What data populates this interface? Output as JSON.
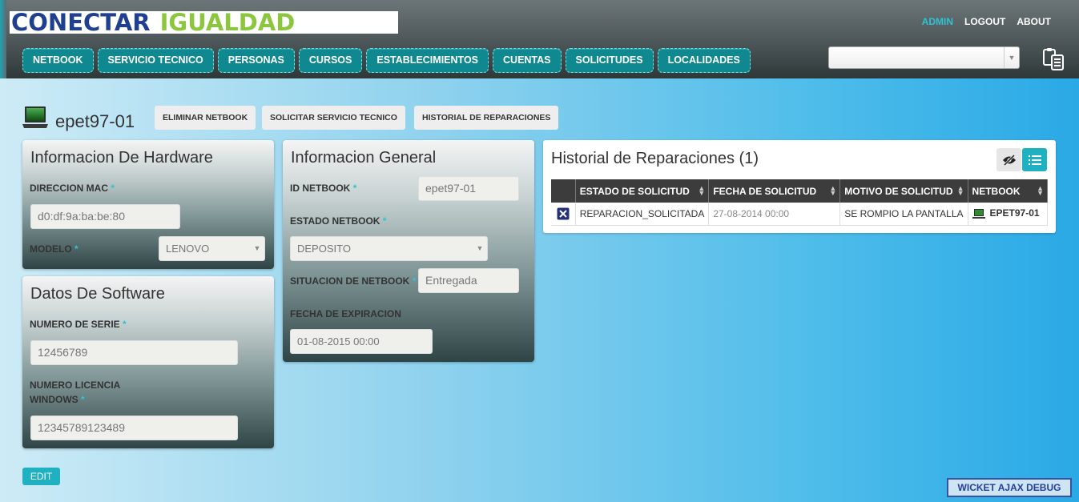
{
  "header": {
    "logo_part1": "CONECTAR",
    "logo_part2": "IGUALDAD",
    "links": [
      "ADMIN",
      "LOGOUT",
      "ABOUT"
    ],
    "nav_items": [
      "NETBOOK",
      "SERVICIO TECNICO",
      "PERSONAS",
      "CURSOS",
      "ESTABLECIMIENTOS",
      "CUENTAS",
      "SOLICITUDES",
      "LOCALIDADES"
    ],
    "select_value": ""
  },
  "page": {
    "title": "epet97-01",
    "actions": [
      "ELIMINAR NETBOOK",
      "SOLICITAR SERVICIO TECNICO",
      "HISTORIAL DE REPARACIONES"
    ],
    "edit_label": "EDIT"
  },
  "hardware": {
    "title": "Informacion De Hardware",
    "mac_label": "DIRECCION MAC",
    "mac_value": "d0:df:9a:ba:be:80",
    "modelo_label": "MODELO",
    "modelo_value": "LENOVO"
  },
  "software": {
    "title": "Datos De Software",
    "serie_label": "NUMERO DE SERIE",
    "serie_value": "12456789",
    "licencia_label_1": "NUMERO LICENCIA",
    "licencia_label_2": "WINDOWS",
    "licencia_value": "12345789123489"
  },
  "general": {
    "title": "Informacion General",
    "id_label": "ID NETBOOK",
    "id_value": "epet97-01",
    "estado_label": "ESTADO NETBOOK",
    "estado_value": "DEPOSITO",
    "situacion_label": "SITUACION DE NETBOOK",
    "situacion_value": "Entregada",
    "fecha_label": "FECHA DE EXPIRACION",
    "fecha_value": "01-08-2015 00:00"
  },
  "historial": {
    "title": "Historial de Reparaciones (1)",
    "columns": [
      "ESTADO DE SOLICITUD",
      "FECHA DE SOLICITUD",
      "MOTIVO DE SOLICITUD",
      "NETBOOK"
    ],
    "rows": [
      {
        "estado": "REPARACION_SOLICITADA",
        "fecha": "27-08-2014 00:00",
        "motivo": "SE ROMPIO LA PANTALLA",
        "netbook": "EPET97-01"
      }
    ]
  },
  "footer": {
    "debug_label": "WICKET AJAX DEBUG"
  },
  "colors": {
    "accent": "#2ec3d4",
    "nav": "#10888f",
    "header": "#4c5557"
  }
}
